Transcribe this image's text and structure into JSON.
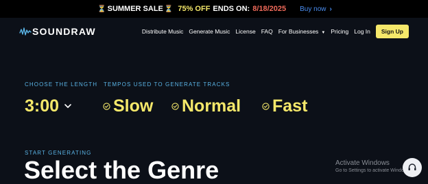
{
  "promo": {
    "hourglass_left": "⏳",
    "sale_text": "SUMMER SALE",
    "hourglass_right": "⏳",
    "discount": "75% OFF",
    "ends_label": "ENDS ON:",
    "end_date": "8/18/2025",
    "buy_label": "Buy now",
    "buy_chevron": "›"
  },
  "header": {
    "logo_text": "SOUNDRAW",
    "nav": [
      {
        "label": "Distribute Music"
      },
      {
        "label": "Generate Music"
      },
      {
        "label": "License"
      },
      {
        "label": "FAQ"
      },
      {
        "label": "For Businesses"
      },
      {
        "label": "Pricing"
      },
      {
        "label": "Log In"
      }
    ],
    "signup_label": "Sign Up"
  },
  "length": {
    "label": "CHOOSE THE LENGTH",
    "value": "3:00"
  },
  "tempos": {
    "label": "TEMPOS USED TO GENERATE TRACKS",
    "options": [
      {
        "name": "Slow",
        "checked": true
      },
      {
        "name": "Normal",
        "checked": true
      },
      {
        "name": "Fast",
        "checked": true
      }
    ]
  },
  "generate": {
    "label": "START GENERATING",
    "title": "Select the Genre"
  },
  "windows_watermark": {
    "title": "Activate Windows",
    "subtitle": "Go to Settings to activate Windows."
  },
  "colors": {
    "background": "#0c1018",
    "accent_yellow": "#f5e86a",
    "label_blue": "#5ab4e6",
    "promo_date": "#f06a5a",
    "buy_link": "#4a8df0"
  },
  "icons": {
    "logo": "waveform-icon",
    "length_dropdown": "chevron-down-icon",
    "tempo_check": "check-circle-icon",
    "support": "headset-icon"
  }
}
